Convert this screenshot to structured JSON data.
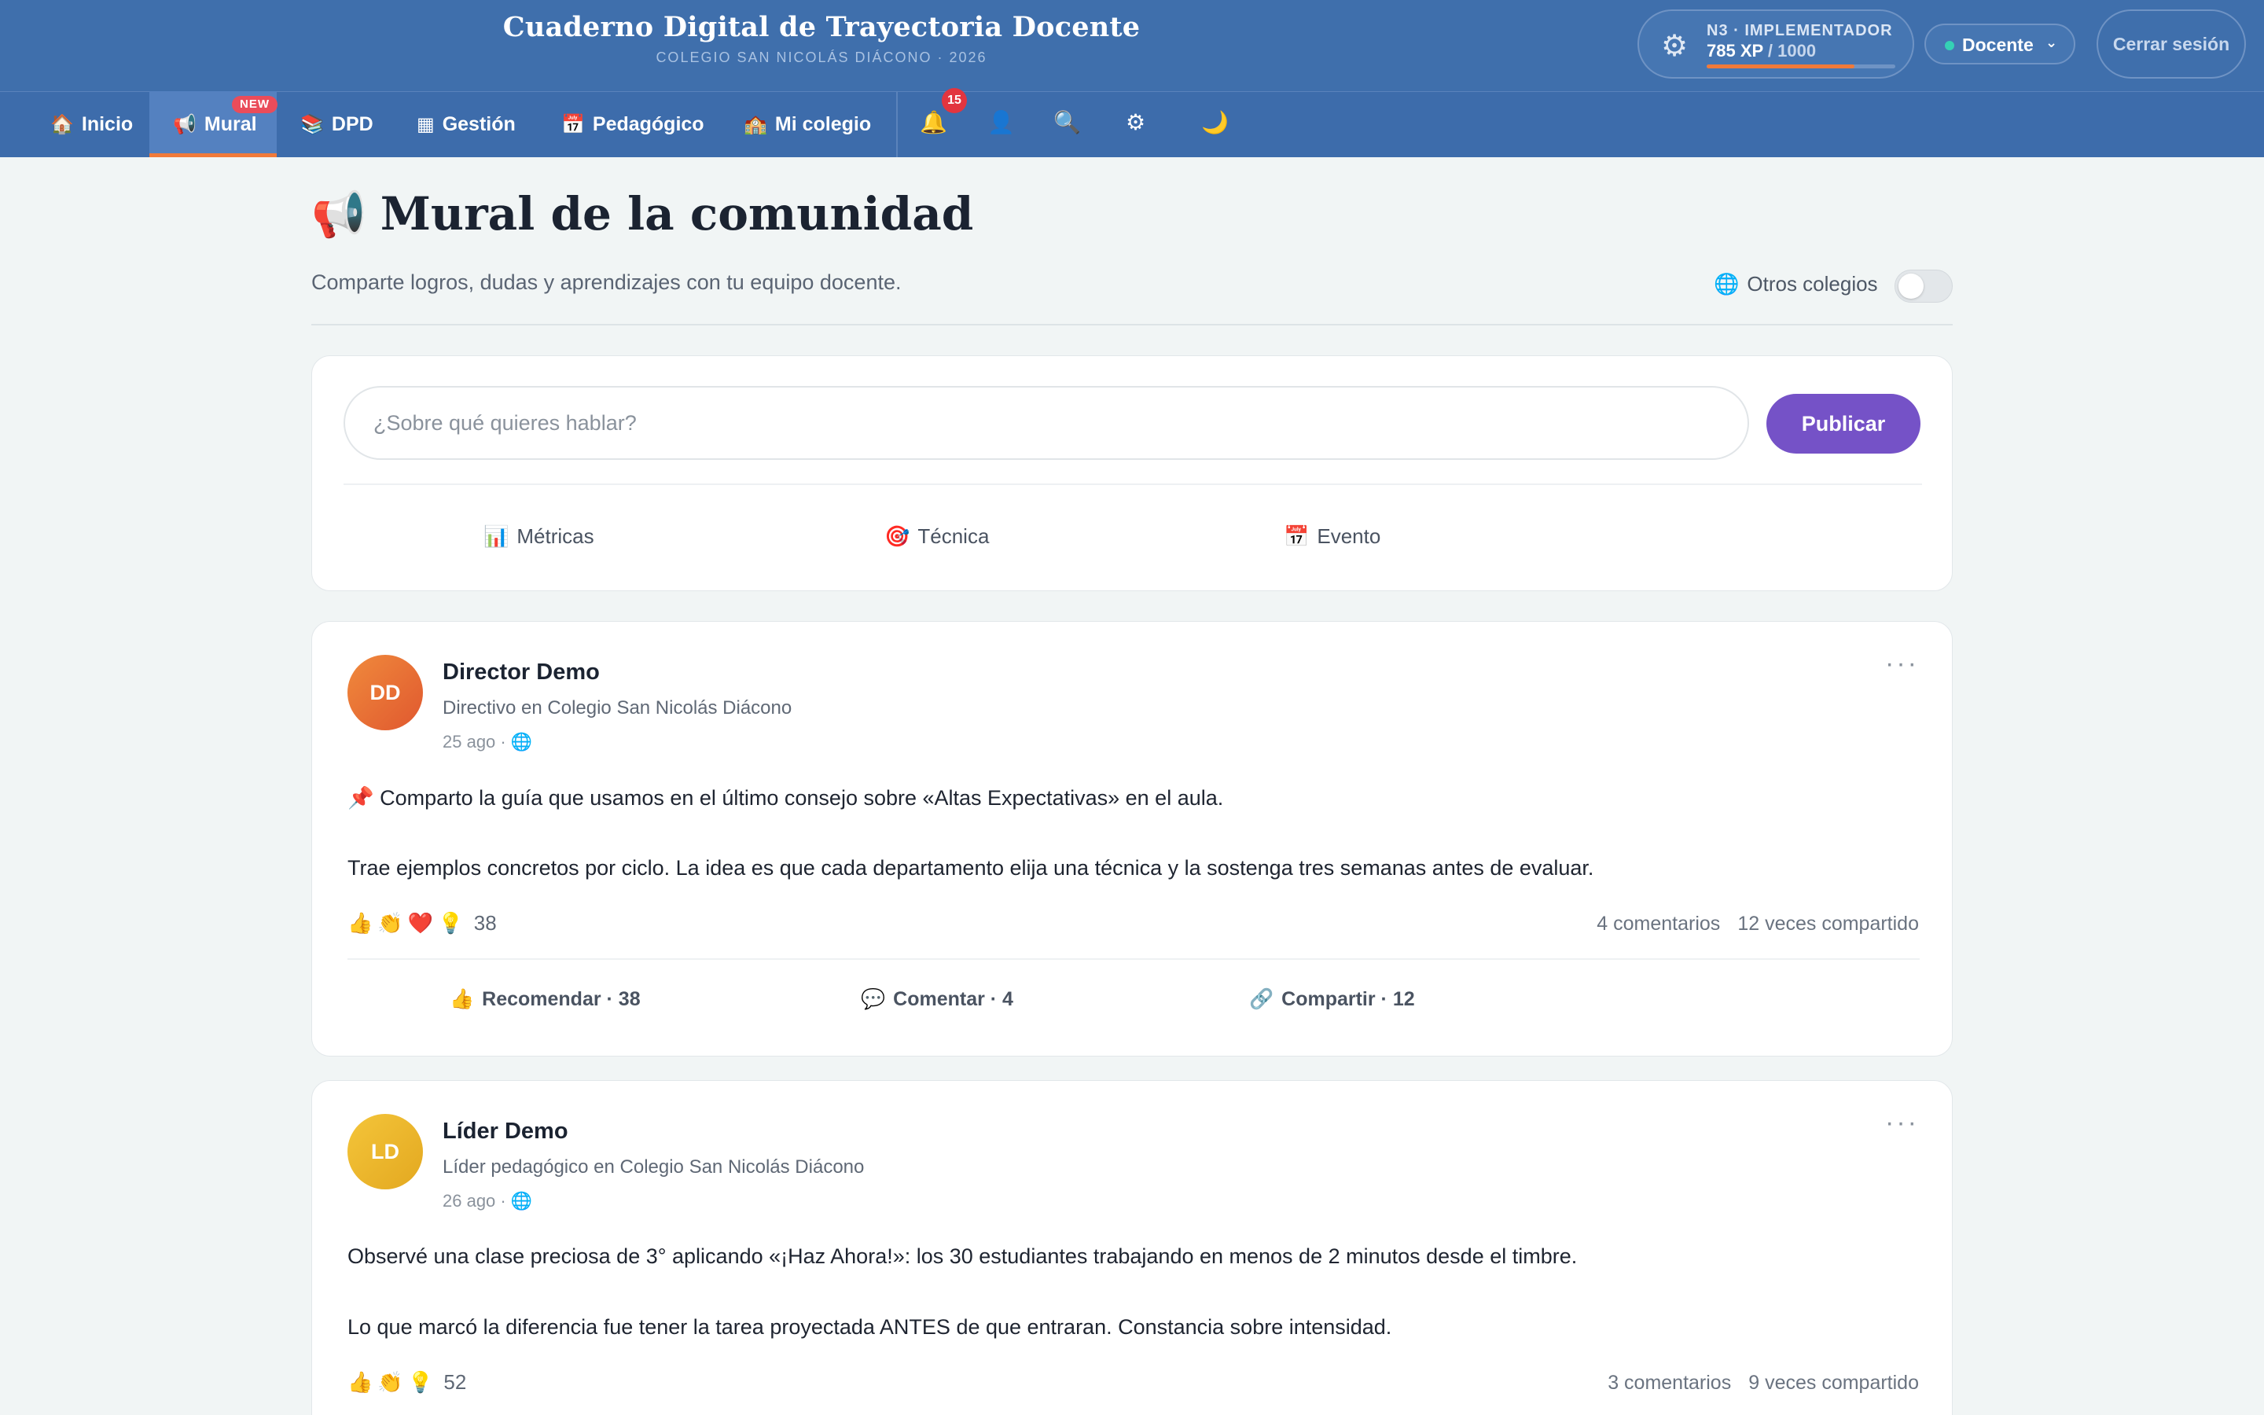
{
  "header": {
    "title": "Cuaderno Digital de Trayectoria Docente",
    "subtitle": "COLEGIO SAN NICOLÁS DIÁCONO · 2026",
    "xp": {
      "level_label": "N3 · IMPLEMENTADOR",
      "value": "785 XP",
      "max": "/ 1000",
      "progress": 0.785
    },
    "role": "Docente",
    "logout": "Cerrar sesión"
  },
  "nav": {
    "items": [
      {
        "label": "Inicio",
        "icon": "house-icon"
      },
      {
        "label": "Mural",
        "icon": "megaphone-icon",
        "badge": "NEW"
      },
      {
        "label": "DPD",
        "icon": "books-icon"
      },
      {
        "label": "Gestión",
        "icon": "grid-icon"
      },
      {
        "label": "Pedagógico",
        "icon": "calendar-icon"
      },
      {
        "label": "Mi colegio",
        "icon": "school-icon"
      }
    ],
    "notifications_count": "15"
  },
  "page": {
    "title": "Mural de la comunidad",
    "subtitle": "Comparte logros, dudas y aprendizajes con tu equipo docente.",
    "other_schools_label": "Otros colegios",
    "other_schools_enabled": false
  },
  "composer": {
    "placeholder": "¿Sobre qué quieres hablar?",
    "publish": "Publicar",
    "actions": [
      "Métricas",
      "Técnica",
      "Evento"
    ]
  },
  "posts": [
    {
      "initials": "DD",
      "author": "Director Demo",
      "role": "Directivo en Colegio San Nicolás Diácono",
      "date": "25 ago ·",
      "lines": [
        "Comparto la guía que usamos en el último consejo sobre «Altas Expectativas» en el aula.",
        "Trae ejemplos concretos por ciclo. La idea es que cada departamento elija una técnica y la sostenga tres semanas antes de evaluar."
      ],
      "reactions_count": "38",
      "comments": "4 comentarios",
      "shares": "12 veces compartido",
      "actions": [
        "Recomendar · 38",
        "Comentar · 4",
        "Compartir · 12"
      ]
    },
    {
      "initials": "LD",
      "author": "Líder Demo",
      "role": "Líder pedagógico en Colegio San Nicolás Diácono",
      "date": "26 ago ·",
      "lines": [
        "Observé una clase preciosa de 3° aplicando «¡Haz Ahora!»: los 30 estudiantes trabajando en menos de 2 minutos desde el timbre.",
        "Lo que marcó la diferencia fue tener la tarea proyectada ANTES de que entraran. Constancia sobre intensidad."
      ],
      "reactions_count": "52",
      "comments": "3 comentarios",
      "shares": "9 veces compartido"
    }
  ],
  "colors": {
    "header": "#3f6fac",
    "accent": "#f07a3a",
    "publish": "#7552c7",
    "badge": "#e2353f"
  }
}
